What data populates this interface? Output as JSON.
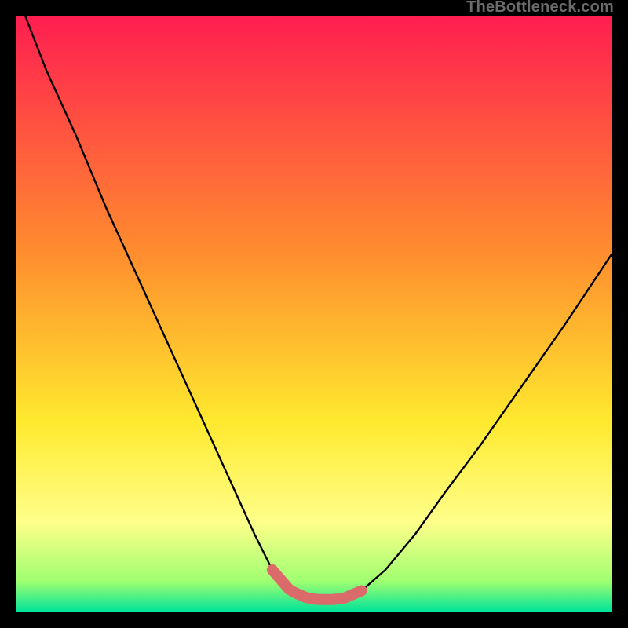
{
  "watermark": "TheBottleneck.com",
  "colors": {
    "frame": "#000000",
    "curve": "#000000",
    "highlight": "#db6a6a",
    "gradient_stops": [
      {
        "offset": "0%",
        "color": "#ff1e50"
      },
      {
        "offset": "40%",
        "color": "#ff8e2e"
      },
      {
        "offset": "68%",
        "color": "#ffe92e"
      },
      {
        "offset": "85%",
        "color": "#ffff8a"
      },
      {
        "offset": "95%",
        "color": "#9eff70"
      },
      {
        "offset": "100%",
        "color": "#00e39a"
      }
    ]
  },
  "chart_data": {
    "type": "line",
    "title": "",
    "xlabel": "",
    "ylabel": "",
    "xlim": [
      0,
      100
    ],
    "ylim": [
      0,
      100
    ],
    "x": [
      1.5,
      5,
      10,
      15,
      20,
      25,
      30,
      35,
      40,
      43,
      46,
      49,
      51,
      53,
      55,
      58,
      62,
      67,
      72,
      78,
      85,
      92,
      100
    ],
    "values": [
      100,
      91,
      80,
      68,
      57,
      46,
      35,
      24,
      13,
      7,
      3.5,
      2.2,
      2.0,
      2.0,
      2.2,
      3.5,
      7,
      13,
      20,
      28,
      38,
      48,
      60
    ],
    "optimal_range_x": [
      43,
      58
    ],
    "grid": false,
    "legend": false
  }
}
